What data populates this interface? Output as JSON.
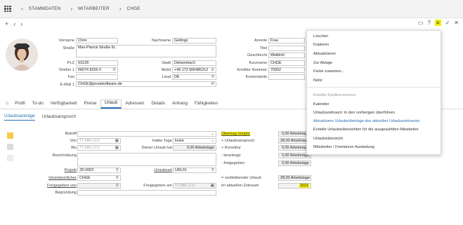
{
  "breadcrumb": [
    "STAMMDATEN",
    "MITARBEITER",
    "CHGE"
  ],
  "toolbar": {
    "add": "+",
    "prev": "‹",
    "next": "›"
  },
  "form": {
    "vorname_label": "Vorname",
    "vorname": "Chris",
    "nachname_label": "Nachname",
    "nachname": "Gellings",
    "anrede_label": "Anrede",
    "anrede": "Frau",
    "strasse_label": "Straße",
    "strasse": "Max-Planck-Straße 6c",
    "titel_label": "Titel",
    "geschlecht_label": "Geschlecht",
    "geschlecht": "Weiblich",
    "plz_label": "PLZ",
    "plz": "63128",
    "stadt_label": "Stadt",
    "stadt": "Dietzenbach",
    "kurzname_label": "Kurzname",
    "kurzname": "CHGE",
    "telefon_label": "Telefon 1",
    "telefon": "06074 8265 0",
    "mobil_label": "Mobil",
    "mobil": "+49 172 666485212",
    "kreditor_label": "Kreditor Nummer",
    "kreditor": "70002",
    "fax_label": "Fax",
    "land_label": "Land",
    "land": "DE",
    "kostenstelle_label": "Kostenstelle",
    "email_label": "E-Mail 1",
    "email": "CHGE@proadsoftware.de"
  },
  "tabs": [
    "Profil",
    "To-do",
    "Verfügbarkeit",
    "Preise",
    "Urlaub",
    "Adressen",
    "Details",
    "Anhang",
    "Fähigkeiten"
  ],
  "active_tab": "Urlaub",
  "subtabs": [
    "Urlaubsanträge",
    "Urlaubsanspruch"
  ],
  "vacation": {
    "betreff_label": "Betreff",
    "von_label": "Von",
    "von_placeholder": "TT.MM.JJJJ",
    "halbe_tage_label": "Halbe Tage",
    "halbe_tage": "keine",
    "bis_label": "Bis",
    "bis_placeholder": "TT.MM.JJJJ",
    "dieser_urlaub_label": "Dieser Urlaub hat",
    "dieser_urlaub": "0,00 Arbeitstage",
    "beschreibung_label": "Beschreibung",
    "projekt_label": "Projekt",
    "projekt": "JD-0002",
    "urlaubsart_label": "Urlaubsart",
    "urlaubsart": "URL01",
    "verantwortlicher_label": "Verantwortlicher",
    "verantwortlicher": "CHGE",
    "freigegeben_von_label": "Freigegeben von",
    "freigegeben_am_label": "Freigegeben am",
    "freigegeben_am_placeholder": "TT.MM.JJJJ",
    "begruendung_label": "Begründung"
  },
  "summary": {
    "uebertrag_label": "Übertrag Vorjahr",
    "uebertrag": "0,00 Arbeitstage",
    "anspruch_label": "+ Urlaubsanspruch",
    "anspruch": "28,00 Arbeitstage",
    "korrektur_label": "+ Korrektur",
    "korrektur": "0,00 Arbeitstage",
    "beantragt_label": "- beantragt",
    "beantragt": "0,00 Arbeitstage",
    "freigegeben_label": "- freigegeben",
    "freigegeben": "0,00 Arbeitstage",
    "verbleibend_label": "= verbleibender Urlaub",
    "verbleibend": "28,00 Arbeitstage",
    "zeitraum_label": "im aktuellen Zeitraum",
    "zeitraum": "2021"
  },
  "menu": {
    "items1": [
      "Löschen",
      "Kopieren",
      "Aktualisieren",
      "Zur Ablage",
      "Farbe zuweisen...",
      "Notiz"
    ],
    "items2": [
      "Erstelle Kreditornummer",
      "Kalender",
      "Urlaubszeitraum: In den vorherigen überführen",
      "Aktualisiere Urlaubsübeträge des aktuellen Urlaubszeitraums",
      "Erstelle Urlaubsübersichten für die ausgewählten Mitarbeiter",
      "Urlaubsübersicht",
      "Mitarbeiter / Freelancer Auslastung"
    ]
  },
  "colors": {
    "accent": "#2a6fb5",
    "highlight": "#f3ed00",
    "side_boxes": [
      "#f6c94c",
      "#dcdcdc",
      "#ececec"
    ]
  }
}
